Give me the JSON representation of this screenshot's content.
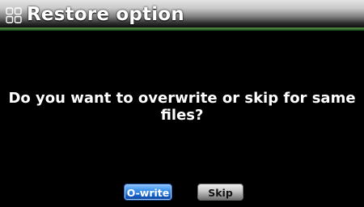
{
  "header": {
    "title": "Restore option",
    "icon": "grid-icon"
  },
  "dialog": {
    "message": "Do you want to overwrite or skip for same files?"
  },
  "buttons": {
    "overwrite_label": "O-write",
    "skip_label": "Skip"
  },
  "colors": {
    "background": "#000000",
    "accent_green": "#2f6a2c",
    "primary_button": "#1762c9",
    "secondary_button": "#b5b5b5"
  }
}
